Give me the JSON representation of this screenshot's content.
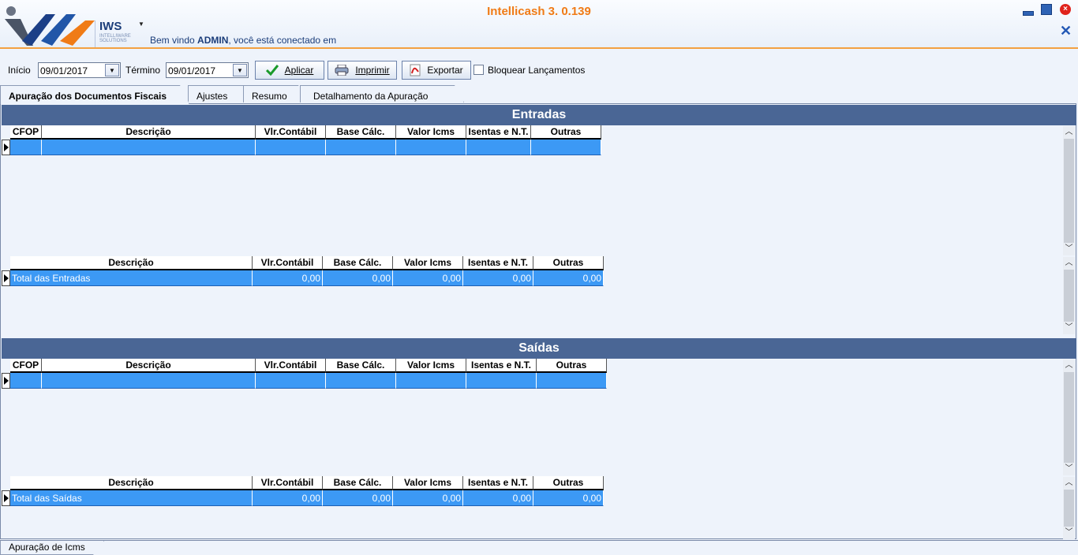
{
  "app": {
    "title": "Intellicash 3. 0.139",
    "logo_text": "IWS",
    "logo_sub": "INTELLIWARE SOLUTIONS",
    "welcome_prefix": "Bem vindo ",
    "welcome_user": "ADMIN",
    "welcome_suffix": ", você está conectado em"
  },
  "toolbar": {
    "start_label": "Início",
    "start_value": "09/01/2017",
    "end_label": "Término",
    "end_value": "09/01/2017",
    "apply_label": "Aplicar",
    "print_label": "Imprimir",
    "export_label": "Exportar",
    "lock_label": "Bloquear Lançamentos"
  },
  "tabs": [
    {
      "label": "Apuração dos Documentos Fiscais",
      "active": true
    },
    {
      "label": "Ajustes"
    },
    {
      "label": "Resumo"
    },
    {
      "label": "Detalhamento da Apuração"
    }
  ],
  "entradas": {
    "title": "Entradas",
    "columns": [
      "CFOP",
      "Descrição",
      "Vlr.Contábil",
      "Base Cálc.",
      "Valor Icms",
      "Isentas e N.T.",
      "Outras"
    ],
    "totals_columns": [
      "Descrição",
      "Vlr.Contábil",
      "Base Cálc.",
      "Valor Icms",
      "Isentas e N.T.",
      "Outras"
    ],
    "totals_row": [
      "Total das Entradas",
      "0,00",
      "0,00",
      "0,00",
      "0,00",
      "0,00"
    ]
  },
  "saidas": {
    "title": "Saídas",
    "columns": [
      "CFOP",
      "Descrição",
      "Vlr.Contábil",
      "Base Cálc.",
      "Valor Icms",
      "Isentas e N.T.",
      "Outras"
    ],
    "totals_columns": [
      "Descrição",
      "Vlr.Contábil",
      "Base Cálc.",
      "Valor Icms",
      "Isentas e N.T.",
      "Outras"
    ],
    "totals_row": [
      "Total das Saídas",
      "0,00",
      "0,00",
      "0,00",
      "0,00",
      "0,00"
    ]
  },
  "bottom_tab": "Apuração de Icms",
  "colors": {
    "accent": "#f07b16",
    "section_header": "#4a6695",
    "row_selected": "#3c99f5"
  }
}
